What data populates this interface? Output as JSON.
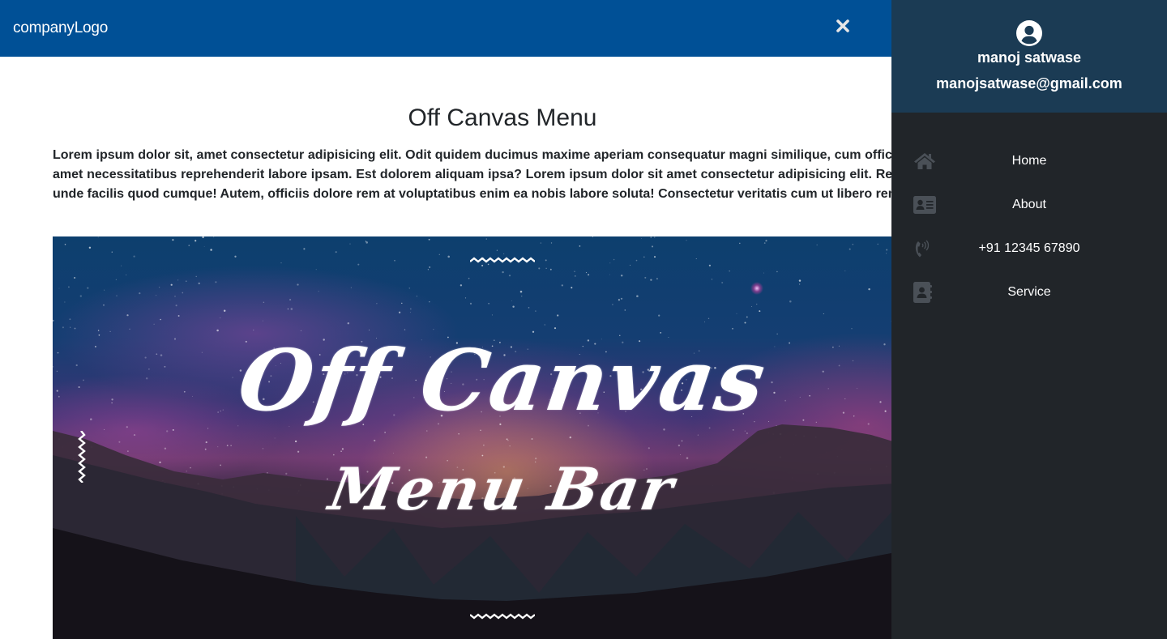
{
  "navbar": {
    "logo_text": "companyLogo",
    "close_icon": "close-icon",
    "background_color": "#005096"
  },
  "main": {
    "title": "Off Canvas Menu",
    "intro_text": "Lorem ipsum dolor sit, amet consectetur adipisicing elit. Odit quidem ducimus maxime aperiam consequatur magni similique, cum officia sint hic amet necessitatibus reprehenderit labore ipsam. Est dolorem aliquam ipsa? Lorem ipsum dolor sit amet consectetur adipisicing elit. Recusandae unde facilis quod cumque! Autem, officiis dolore rem at voluptatibus enim ea nobis labore soluta! Consectetur veritatis cum ut libero rem?",
    "hero": {
      "title_line1": "Off Canvas",
      "title_line2": "Menu Bar",
      "description": "night sky with milky way over mountains"
    }
  },
  "sidebar": {
    "header_color": "#1b3b54",
    "body_color": "#212529",
    "user": {
      "avatar_icon": "user-circle-icon",
      "name": "manoj satwase",
      "email": "manojsatwase@gmail.com"
    },
    "items": [
      {
        "label": "Home",
        "icon": "home-icon"
      },
      {
        "label": "About",
        "icon": "id-card-icon"
      },
      {
        "label": "+91 12345 67890",
        "icon": "phone-volume-icon"
      },
      {
        "label": "Service",
        "icon": "address-book-icon"
      }
    ]
  }
}
